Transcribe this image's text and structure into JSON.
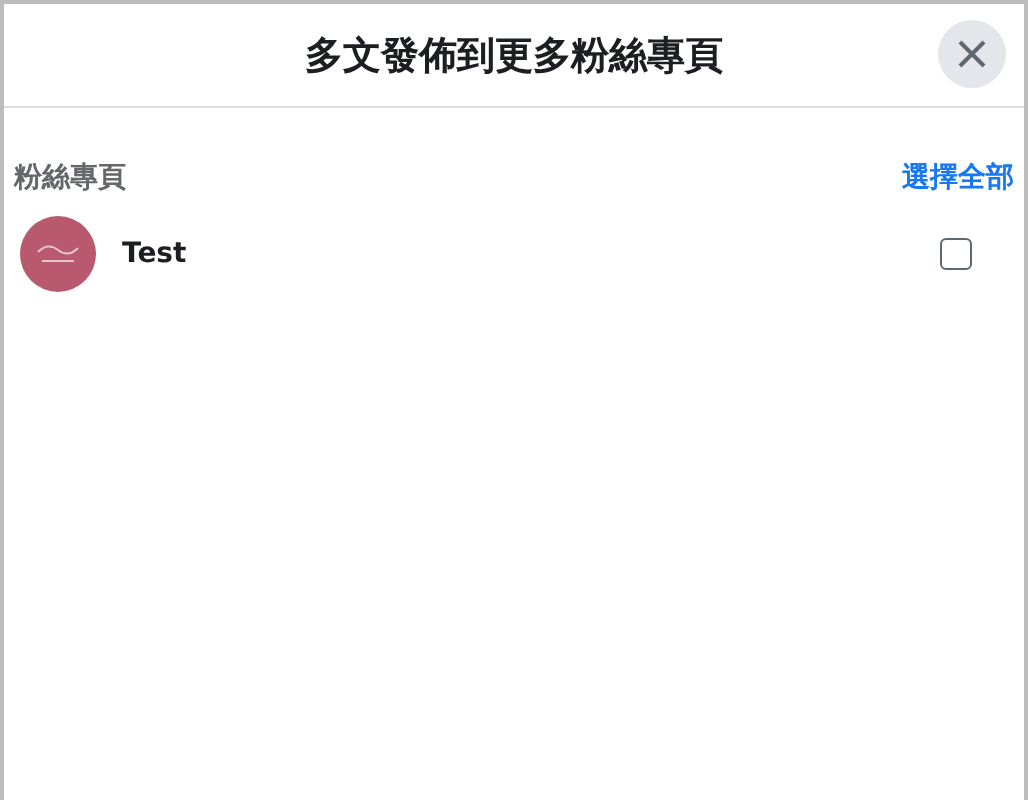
{
  "dialog": {
    "title": "多文發佈到更多粉絲專頁"
  },
  "section": {
    "label": "粉絲專頁",
    "select_all": "選擇全部"
  },
  "pages": [
    {
      "name": "Test",
      "checked": false
    }
  ]
}
